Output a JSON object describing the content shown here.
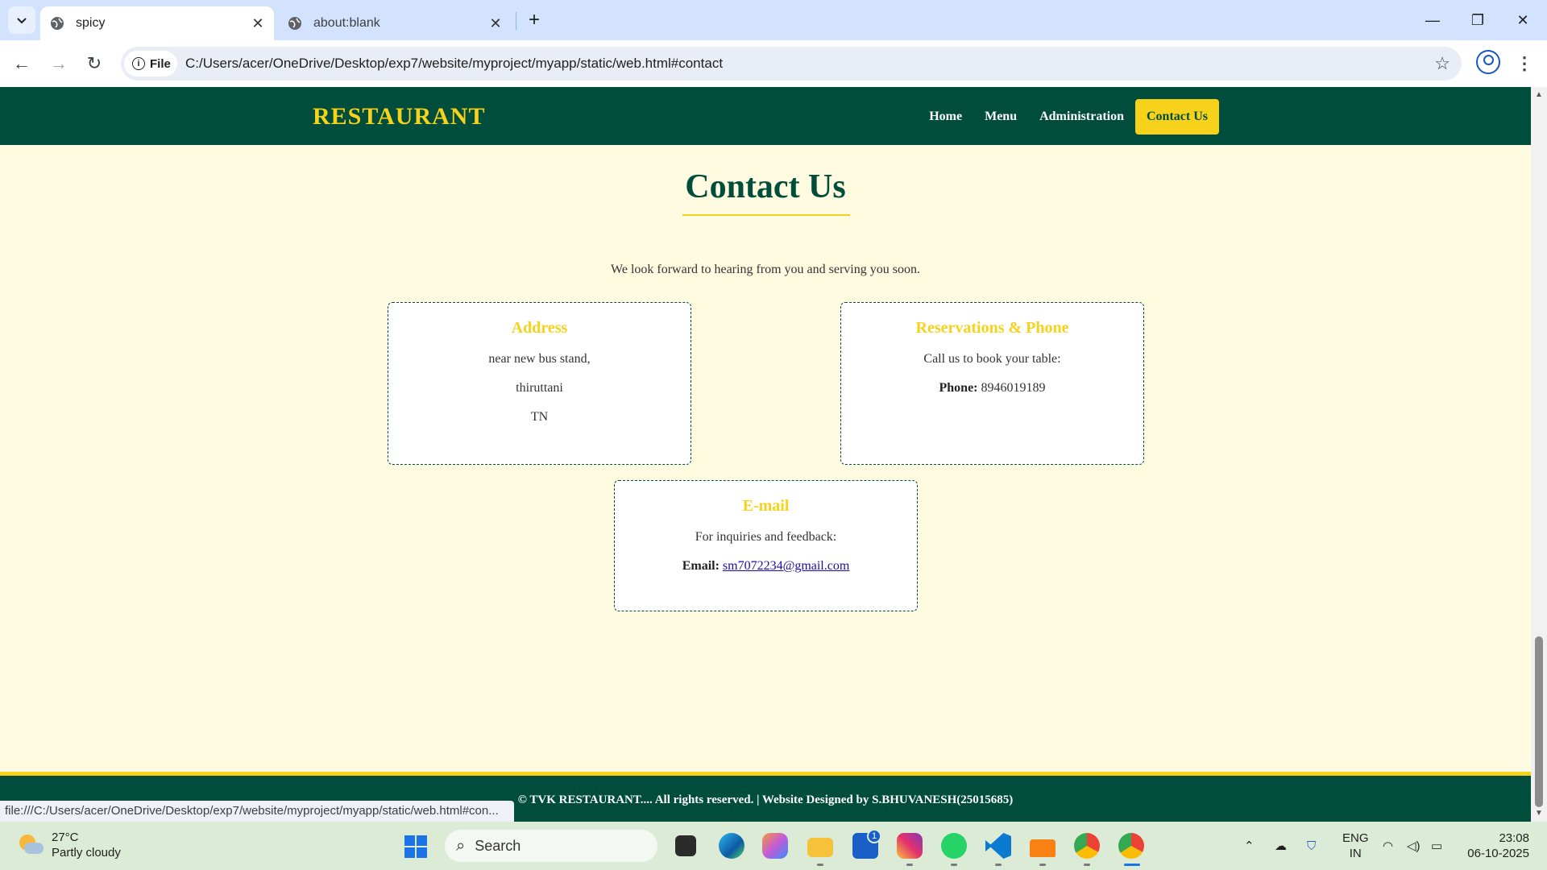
{
  "browser": {
    "tabs": [
      {
        "title": "spicy",
        "active": true
      },
      {
        "title": "about:blank",
        "active": false
      }
    ],
    "chip_label": "File",
    "url": "C:/Users/acer/OneDrive/Desktop/exp7/website/myproject/myapp/static/web.html#contact",
    "status_url": "file:///C:/Users/acer/OneDrive/Desktop/exp7/website/myproject/myapp/static/web.html#con..."
  },
  "site": {
    "brand": "RESTAURANT",
    "nav": [
      {
        "label": "Home"
      },
      {
        "label": "Menu"
      },
      {
        "label": "Administration"
      },
      {
        "label": "Contact Us",
        "active": true
      }
    ],
    "contact": {
      "heading": "Contact Us",
      "intro": "We look forward to hearing from you and serving you soon.",
      "address": {
        "title": "Address",
        "lines": [
          "near new bus stand,",
          "thiruttani",
          "TN"
        ]
      },
      "reservations": {
        "title": "Reservations & Phone",
        "text": "Call us to book your table:",
        "phone_label": "Phone:",
        "phone": "8946019189"
      },
      "email": {
        "title": "E-mail",
        "text": "For inquiries and feedback:",
        "email_label": "Email:",
        "email": "sm7072234@gmail.com"
      }
    },
    "footer": "© TVK RESTAURANT.... All rights reserved. | Website Designed by S.BHUVANESH(25015685)"
  },
  "colors": {
    "primary": "#004d3b",
    "accent": "#f7d21a",
    "background": "#fffbe0"
  },
  "taskbar": {
    "weather_temp": "27°C",
    "weather_desc": "Partly cloudy",
    "search_placeholder": "Search",
    "store_badge": "1",
    "lang_top": "ENG",
    "lang_bottom": "IN",
    "time": "23:08",
    "date": "06-10-2025",
    "icons": [
      "file-explorer-icon",
      "edge-icon",
      "copilot-icon",
      "folder-icon",
      "store-icon",
      "instagram-icon",
      "whatsapp-icon",
      "vscode-icon",
      "moodle-icon",
      "chrome-icon",
      "chrome-active-icon"
    ]
  }
}
